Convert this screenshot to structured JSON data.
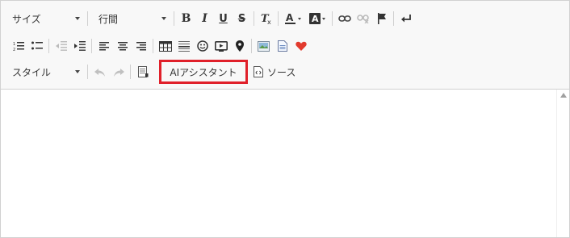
{
  "toolbar": {
    "size_dropdown": "サイズ",
    "line_height_dropdown": "行間",
    "style_dropdown": "スタイル",
    "ai_assistant": "AIアシスタント",
    "source": "ソース",
    "bold": "B",
    "italic": "I",
    "underline": "U",
    "strike": "S",
    "clear_format": "T"
  },
  "colors": {
    "highlight_border": "#e0202a",
    "toolbar_bg": "#f8f8f8",
    "heart": "#e23b2e"
  }
}
